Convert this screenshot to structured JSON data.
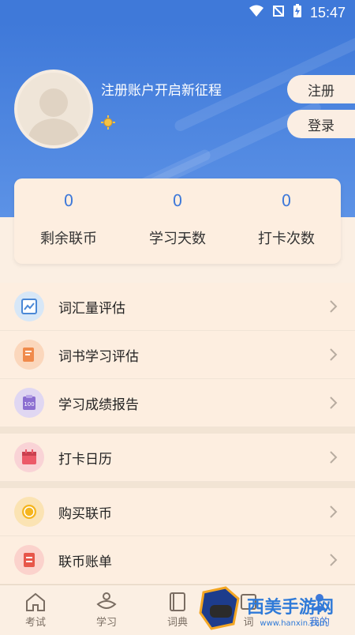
{
  "status_bar": {
    "time": "15:47"
  },
  "profile": {
    "slogan": "注册账户开启新征程"
  },
  "auth": {
    "register_label": "注册",
    "login_label": "登录"
  },
  "stats": [
    {
      "value": "0",
      "label": "剩余联币"
    },
    {
      "value": "0",
      "label": "学习天数"
    },
    {
      "value": "0",
      "label": "打卡次数"
    }
  ],
  "menu": {
    "group1": [
      {
        "label": "词汇量评估",
        "icon": "vocab-assessment-icon"
      },
      {
        "label": "词书学习评估",
        "icon": "wordbook-assessment-icon"
      },
      {
        "label": "学习成绩报告",
        "icon": "score-report-icon"
      }
    ],
    "group2": [
      {
        "label": "打卡日历",
        "icon": "calendar-icon"
      }
    ],
    "group3": [
      {
        "label": "购买联币",
        "icon": "coin-icon"
      },
      {
        "label": "联币账单",
        "icon": "bill-icon"
      }
    ]
  },
  "tabs": [
    {
      "label": "考试",
      "icon": "home-icon"
    },
    {
      "label": "学习",
      "icon": "study-icon"
    },
    {
      "label": "词典",
      "icon": "dictionary-icon"
    },
    {
      "label": "词",
      "icon": "word-icon"
    },
    {
      "label": "我的",
      "icon": "profile-icon"
    }
  ],
  "watermark": {
    "text": "西美手游网",
    "url": "www.hanxin.com"
  },
  "colors": {
    "primary": "#3f79d9",
    "background": "#fbefe3"
  }
}
